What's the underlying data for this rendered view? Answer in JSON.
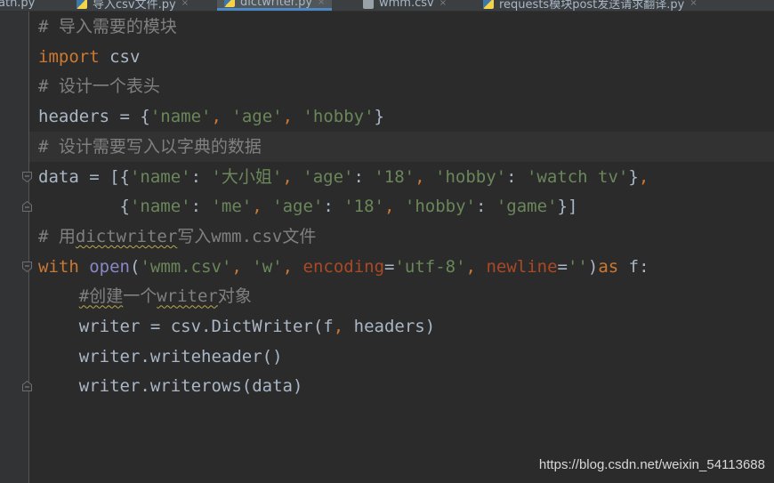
{
  "tabs": [
    {
      "label": "ath.py",
      "icon": "python-file-icon",
      "active": false
    },
    {
      "label": "导入csv文件.py",
      "icon": "python-file-icon",
      "active": false
    },
    {
      "label": "dictwriter.py",
      "icon": "python-file-icon",
      "active": true
    },
    {
      "label": "wmm.csv",
      "icon": "csv-file-icon",
      "active": false
    },
    {
      "label": "requests模块post发送请求翻译.py",
      "icon": "python-file-icon",
      "active": false
    }
  ],
  "code_lines": [
    [
      {
        "t": "# 导入需要的模块",
        "c": "comment"
      }
    ],
    [
      {
        "t": "import",
        "c": "kw"
      },
      {
        "t": " csv",
        "c": "id"
      }
    ],
    [
      {
        "t": "# 设计一个表头",
        "c": "comment"
      }
    ],
    [
      {
        "t": "headers = {",
        "c": "id"
      },
      {
        "t": "'name'",
        "c": "str"
      },
      {
        "t": ", ",
        "c": "comma"
      },
      {
        "t": "'age'",
        "c": "str"
      },
      {
        "t": ", ",
        "c": "comma"
      },
      {
        "t": "'hobby'",
        "c": "str"
      },
      {
        "t": "}",
        "c": "id"
      }
    ],
    [
      {
        "t": "# 设计需要写入以字典的数据",
        "c": "comment"
      }
    ],
    [
      {
        "t": "data = [{",
        "c": "id"
      },
      {
        "t": "'name'",
        "c": "str"
      },
      {
        "t": ": ",
        "c": "id"
      },
      {
        "t": "'大小姐'",
        "c": "str"
      },
      {
        "t": ", ",
        "c": "comma"
      },
      {
        "t": "'age'",
        "c": "str"
      },
      {
        "t": ": ",
        "c": "id"
      },
      {
        "t": "'18'",
        "c": "str"
      },
      {
        "t": ", ",
        "c": "comma"
      },
      {
        "t": "'hobby'",
        "c": "str"
      },
      {
        "t": ": ",
        "c": "id"
      },
      {
        "t": "'watch tv'",
        "c": "str"
      },
      {
        "t": "}",
        "c": "id"
      },
      {
        "t": ",",
        "c": "comma"
      }
    ],
    [
      {
        "t": "        {",
        "c": "id"
      },
      {
        "t": "'name'",
        "c": "str"
      },
      {
        "t": ": ",
        "c": "id"
      },
      {
        "t": "'me'",
        "c": "str"
      },
      {
        "t": ", ",
        "c": "comma"
      },
      {
        "t": "'age'",
        "c": "str"
      },
      {
        "t": ": ",
        "c": "id"
      },
      {
        "t": "'18'",
        "c": "str"
      },
      {
        "t": ", ",
        "c": "comma"
      },
      {
        "t": "'hobby'",
        "c": "str"
      },
      {
        "t": ": ",
        "c": "id"
      },
      {
        "t": "'game'",
        "c": "str"
      },
      {
        "t": "}]",
        "c": "id"
      }
    ],
    [
      {
        "t": "# 用",
        "c": "comment"
      },
      {
        "t": "dictwriter",
        "c": "comment",
        "sq": true
      },
      {
        "t": "写入wmm.csv文件",
        "c": "comment"
      }
    ],
    [
      {
        "t": "with",
        "c": "kw"
      },
      {
        "t": " ",
        "c": "id"
      },
      {
        "t": "open",
        "c": "builtin"
      },
      {
        "t": "(",
        "c": "id"
      },
      {
        "t": "'wmm.csv'",
        "c": "str"
      },
      {
        "t": ", ",
        "c": "comma"
      },
      {
        "t": "'w'",
        "c": "str"
      },
      {
        "t": ", ",
        "c": "comma"
      },
      {
        "t": "encoding",
        "c": "param"
      },
      {
        "t": "=",
        "c": "id"
      },
      {
        "t": "'utf-8'",
        "c": "str"
      },
      {
        "t": ", ",
        "c": "comma"
      },
      {
        "t": "newline",
        "c": "param"
      },
      {
        "t": "=",
        "c": "id"
      },
      {
        "t": "''",
        "c": "str"
      },
      {
        "t": ")",
        "c": "id"
      },
      {
        "t": "as",
        "c": "kw"
      },
      {
        "t": " f:",
        "c": "id"
      }
    ],
    [
      {
        "t": "    ",
        "c": "id"
      },
      {
        "t": "#创建",
        "c": "comment",
        "sq": true
      },
      {
        "t": "一个",
        "c": "comment"
      },
      {
        "t": "writer",
        "c": "comment",
        "sq": true
      },
      {
        "t": "对象",
        "c": "comment"
      }
    ],
    [
      {
        "t": "    writer = csv.DictWriter(f",
        "c": "id"
      },
      {
        "t": ", ",
        "c": "comma"
      },
      {
        "t": "headers)",
        "c": "id"
      }
    ],
    [
      {
        "t": "    writer.writeheader()",
        "c": "id"
      }
    ],
    [
      {
        "t": "    writer.writerows(data)",
        "c": "id"
      }
    ]
  ],
  "current_line_index": 4,
  "fold_markers": [
    {
      "line": 5,
      "kind": "start"
    },
    {
      "line": 6,
      "kind": "end"
    },
    {
      "line": 8,
      "kind": "start"
    },
    {
      "line": 12,
      "kind": "end"
    }
  ],
  "watermark": "https://blog.csdn.net/weixin_54113688",
  "colors": {
    "background": "#2b2b2b",
    "keyword": "#cc7832",
    "string": "#6a8759",
    "comment": "#808080",
    "builtin": "#8888c6",
    "param": "#aa4926",
    "text": "#a9b7c6"
  }
}
